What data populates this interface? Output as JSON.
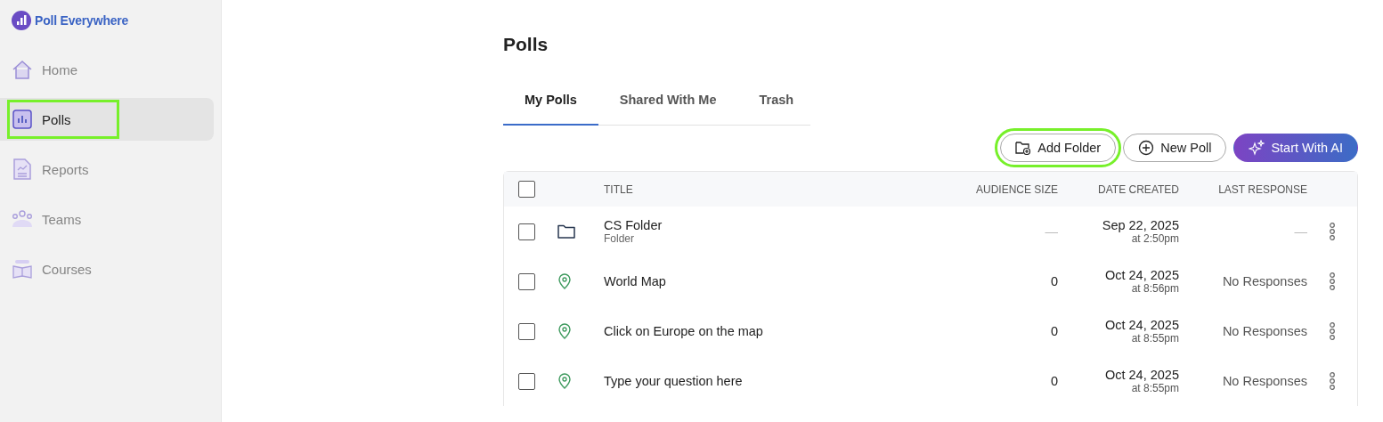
{
  "brand": {
    "name": "Poll Everywhere"
  },
  "sidebar": {
    "items": [
      {
        "label": "Home",
        "kind": "home",
        "selected": false,
        "highlighted": false
      },
      {
        "label": "Polls",
        "kind": "polls",
        "selected": true,
        "highlighted": true
      },
      {
        "label": "Reports",
        "kind": "reports",
        "selected": false,
        "highlighted": false
      },
      {
        "label": "Teams",
        "kind": "teams",
        "selected": false,
        "highlighted": false
      },
      {
        "label": "Courses",
        "kind": "courses",
        "selected": false,
        "highlighted": false
      }
    ]
  },
  "page": {
    "title": "Polls"
  },
  "tabs": [
    {
      "label": "My Polls",
      "selected": true
    },
    {
      "label": "Shared With Me",
      "selected": false
    },
    {
      "label": "Trash",
      "selected": false
    }
  ],
  "actions": [
    {
      "label": "Add Folder",
      "kind": "folder",
      "highlighted": true
    },
    {
      "label": "New Poll",
      "kind": "new",
      "highlighted": false
    },
    {
      "label": "Start With AI",
      "kind": "ai",
      "highlighted": false
    }
  ],
  "table": {
    "select_all_checked": false,
    "columns": [
      "TITLE",
      "AUDIENCE SIZE",
      "DATE CREATED",
      "LAST RESPONSE"
    ],
    "rows": [
      {
        "kind": "folder",
        "checked": false,
        "title": "CS Folder",
        "subtitle": "Folder",
        "audience": "—",
        "date": "Sep 22, 2025",
        "time": "at 2:50pm",
        "last_response": "—"
      },
      {
        "kind": "map",
        "checked": false,
        "title": "World Map",
        "audience": "0",
        "date": "Oct 24, 2025",
        "time": "at 8:56pm",
        "last_response": "No Responses"
      },
      {
        "kind": "map",
        "checked": false,
        "title": "Click on Europe on the map",
        "audience": "0",
        "date": "Oct 24, 2025",
        "time": "at 8:55pm",
        "last_response": "No Responses"
      },
      {
        "kind": "map",
        "checked": false,
        "title": "Type your question here",
        "audience": "0",
        "date": "Oct 24, 2025",
        "time": "at 8:55pm",
        "last_response": "No Responses"
      }
    ]
  }
}
